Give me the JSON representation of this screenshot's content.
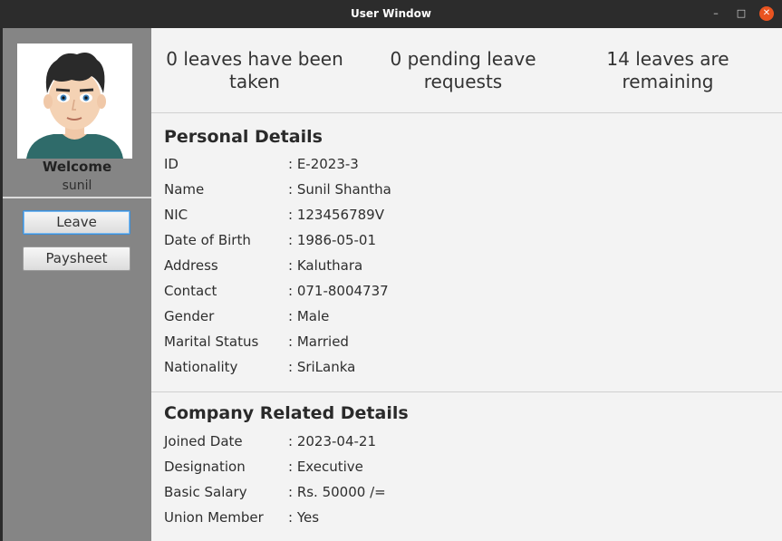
{
  "window": {
    "title": "User Window",
    "minimize": "–",
    "maximize": "□",
    "close": "✕"
  },
  "sidebar": {
    "welcome": "Welcome",
    "username": "sunil",
    "avatar_icon": "user-avatar",
    "buttons": {
      "leave": "Leave",
      "paysheet": "Paysheet"
    }
  },
  "stats": {
    "taken": "0 leaves have been taken",
    "pending": "0 pending leave requests",
    "remaining": "14 leaves are remaining"
  },
  "personal": {
    "title": "Personal Details",
    "rows": [
      {
        "label": "ID",
        "value": ": E-2023-3"
      },
      {
        "label": "Name",
        "value": ": Sunil Shantha"
      },
      {
        "label": "NIC",
        "value": ": 123456789V"
      },
      {
        "label": "Date of Birth",
        "value": ": 1986-05-01"
      },
      {
        "label": "Address",
        "value": ": Kaluthara"
      },
      {
        "label": "Contact",
        "value": ": 071-8004737"
      },
      {
        "label": "Gender",
        "value": ": Male"
      },
      {
        "label": "Marital Status",
        "value": ": Married"
      },
      {
        "label": "Nationality",
        "value": ": SriLanka"
      }
    ]
  },
  "company": {
    "title": "Company Related Details",
    "rows": [
      {
        "label": "Joined Date",
        "value": ": 2023-04-21"
      },
      {
        "label": "Designation",
        "value": ": Executive"
      },
      {
        "label": "Basic Salary",
        "value": ": Rs. 50000 /="
      },
      {
        "label": "Union Member",
        "value": ": Yes"
      }
    ]
  }
}
